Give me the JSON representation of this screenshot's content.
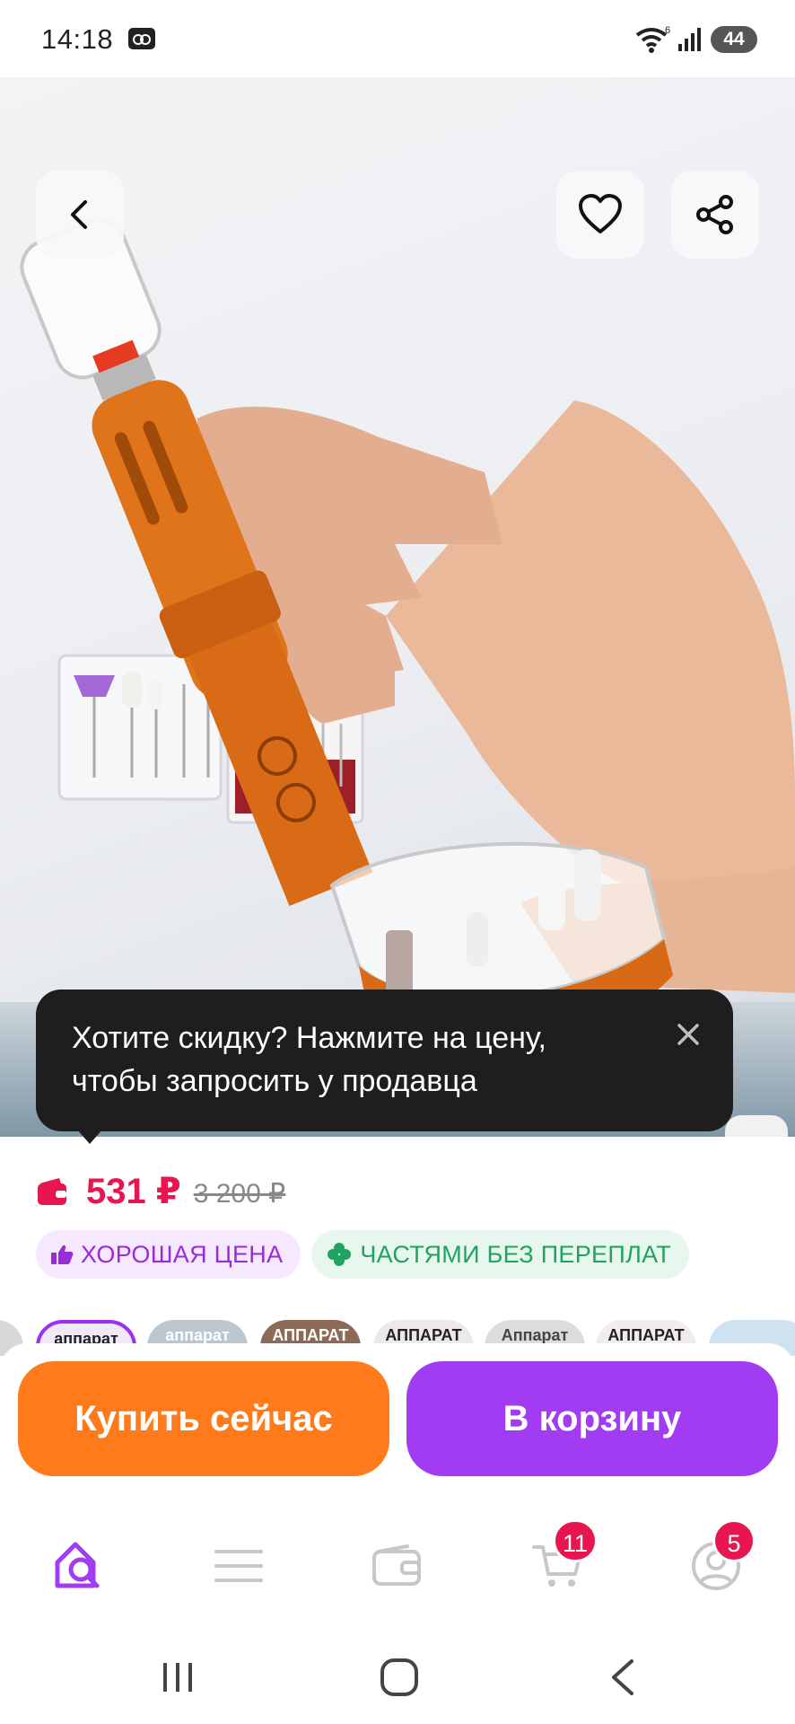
{
  "status_bar": {
    "time": "14:18",
    "wifi_superscript": "6",
    "battery": "44"
  },
  "product": {
    "price_current": "531 ₽",
    "price_old": "3 200 ₽",
    "badges": {
      "good_price": "ХОРОШАЯ ЦЕНА",
      "installments": "ЧАСТЯМИ БЕЗ ПЕРЕПЛАТ"
    }
  },
  "tooltip": {
    "text": "Хотите скидку? Нажмите на цену, чтобы запросить у продавца"
  },
  "thumbnails": [
    "аппарат",
    "аппарат",
    "АППАРАТ",
    "АППАРАТ",
    "Аппарат",
    "АППАРАТ"
  ],
  "actions": {
    "buy_now": "Купить сейчас",
    "add_to_cart": "В корзину"
  },
  "bottom_nav": {
    "cart_badge": "11",
    "profile_badge": "5"
  },
  "colors": {
    "accent_purple": "#a23cf2",
    "accent_orange": "#ff7a1a",
    "price_red": "#e8164f"
  }
}
